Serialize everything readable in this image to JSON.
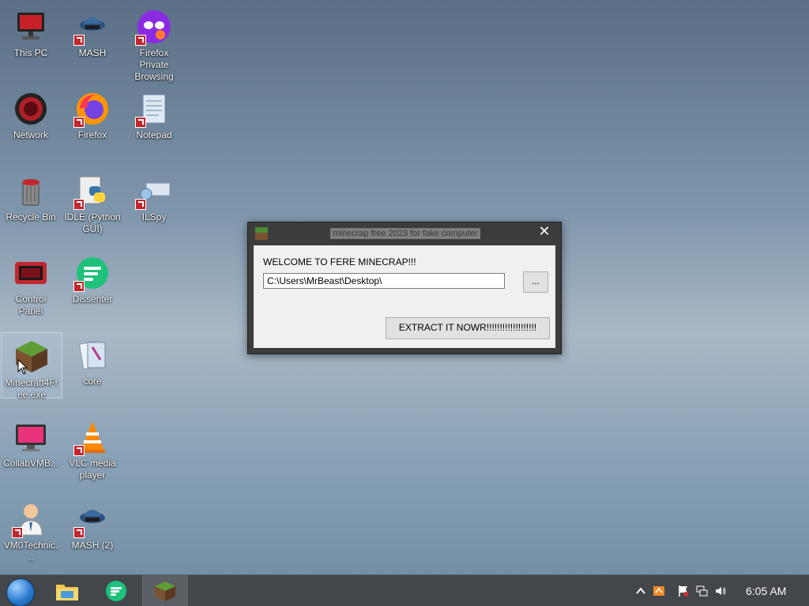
{
  "desktop": {
    "icons": [
      {
        "label": "This PC",
        "icon": "this-pc-icon"
      },
      {
        "label": "MASH",
        "icon": "mash-icon"
      },
      {
        "label": "Firefox Private Browsing",
        "icon": "firefox-private-icon"
      },
      {
        "label": "Network",
        "icon": "network-icon"
      },
      {
        "label": "Firefox",
        "icon": "firefox-icon"
      },
      {
        "label": "Notepad",
        "icon": "notepad-icon"
      },
      {
        "label": "Recycle Bin",
        "icon": "recycle-bin-icon"
      },
      {
        "label": "IDLE (Python GUI)",
        "icon": "python-idle-icon"
      },
      {
        "label": "ILSpy",
        "icon": "ilspy-icon"
      },
      {
        "label": "Control Panel",
        "icon": "control-panel-icon"
      },
      {
        "label": "Dissenter",
        "icon": "dissenter-icon"
      },
      {
        "label": "Minecraft4Free.exe",
        "icon": "minecraft-icon",
        "selected": true
      },
      {
        "label": "core",
        "icon": "core-icon"
      },
      {
        "label": "CollabVMB...",
        "icon": "collabvm-icon"
      },
      {
        "label": "VLC media player",
        "icon": "vlc-icon"
      },
      {
        "label": "VM0Technic...",
        "icon": "vm0-technician-icon"
      },
      {
        "label": "MASH (2)",
        "icon": "mash-icon"
      }
    ]
  },
  "dialog": {
    "title": "minecrap free 2023 for fake computer",
    "close": "✕",
    "welcome": "WELCOME TO FERE MINECRAP!!!",
    "path_value": "C:\\Users\\MrBeast\\Desktop\\",
    "browse_label": "...",
    "extract_label": "EXTRACT IT NOWR!!!!!!!!!!!!!!!!!!!"
  },
  "taskbar": {
    "items": [
      {
        "name": "file-explorer",
        "icon": "folder-icon"
      },
      {
        "name": "dissenter",
        "icon": "dissenter-icon"
      },
      {
        "name": "minecraft",
        "icon": "minecraft-icon",
        "active": true
      }
    ],
    "tray": {
      "icons": [
        "chevron-up-icon",
        "notification-icon",
        "flag-icon",
        "network-icon",
        "volume-icon"
      ]
    },
    "clock": "6:05 AM"
  },
  "colors": {
    "taskbar": "#43464b",
    "dialog_frame": "#3c3c3c",
    "dialog_client": "#f0f0f0",
    "shortcut_badge": "#c2272d"
  }
}
